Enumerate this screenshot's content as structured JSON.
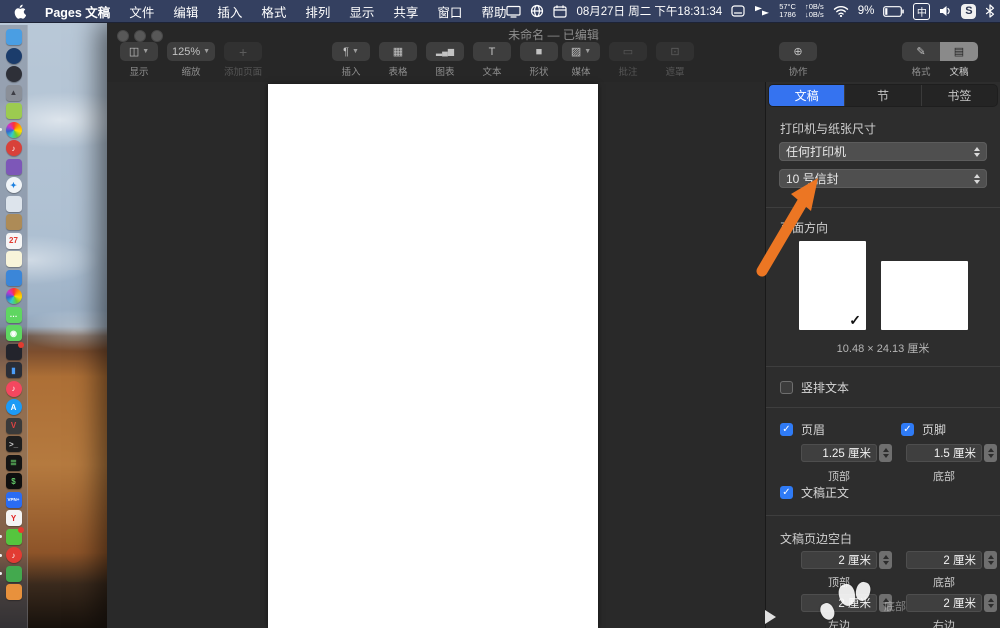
{
  "menubar": {
    "app_name": "Pages 文稿",
    "menus": [
      "文件",
      "编辑",
      "插入",
      "格式",
      "排列",
      "显示",
      "共享",
      "窗口",
      "帮助"
    ],
    "status": {
      "date_time": "08月27日 周二 下午18:31:34",
      "temp_top": "57°C",
      "temp_bottom": "1786",
      "net_up": "↑0B/s",
      "net_down": "↓0B/s",
      "battery_pct": "9%",
      "input_method": "中",
      "sogou": "S",
      "icons": [
        "display-icon",
        "globe-icon",
        "calendar-icon",
        "touchbar-icon",
        "flags-icon",
        "wifi-icon",
        "battery-icon",
        "input-method-badge",
        "speaker-icon",
        "sogou-badge",
        "bluetooth-icon"
      ]
    }
  },
  "window": {
    "title": "未命名 — 已编辑",
    "toolbar": {
      "groups": [
        [
          {
            "name": "view",
            "label": "显示",
            "glyph": "◫",
            "chevron": true
          },
          {
            "name": "zoom",
            "label": "缩放",
            "glyph": "125%",
            "chevron": true
          },
          {
            "name": "add-page",
            "label": "添加页面",
            "glyph": "+",
            "disabled": true
          }
        ],
        [
          {
            "name": "insert",
            "label": "插入",
            "glyph": "¶",
            "chevron": true
          },
          {
            "name": "table",
            "label": "表格",
            "glyph": "▦"
          },
          {
            "name": "chart",
            "label": "图表",
            "glyph": "▂▄▆"
          },
          {
            "name": "text",
            "label": "文本",
            "glyph": "T"
          },
          {
            "name": "shape",
            "label": "形状",
            "glyph": "■"
          }
        ],
        [
          {
            "name": "media",
            "label": "媒体",
            "glyph": "▨",
            "chevron": true
          },
          {
            "name": "comment",
            "label": "批注",
            "glyph": "▭",
            "disabled": true
          },
          {
            "name": "mask",
            "label": "遮罩",
            "glyph": "⊡",
            "disabled": true
          }
        ],
        [
          {
            "name": "collaborate",
            "label": "协作",
            "glyph": "⊕"
          }
        ],
        [
          {
            "name": "format",
            "label": "格式",
            "glyph": "✎"
          },
          {
            "name": "document",
            "label": "文稿",
            "glyph": "▤",
            "active": true
          }
        ]
      ]
    }
  },
  "sidebar": {
    "tabs": [
      {
        "label": "文稿",
        "active": true
      },
      {
        "label": "节",
        "active": false
      },
      {
        "label": "书签",
        "active": false
      }
    ],
    "printer": {
      "title": "打印机与纸张尺寸",
      "printer_value": "任何打印机",
      "paper_value": "10 号信封"
    },
    "orientation": {
      "title": "页面方向",
      "size_label": "10.48 × 24.13 厘米"
    },
    "vertical_text": {
      "label": "竖排文本",
      "checked": false
    },
    "header": {
      "label": "页眉",
      "checked": true,
      "value": "1.25 厘米",
      "pos": "顶部"
    },
    "footer": {
      "label": "页脚",
      "checked": true,
      "value": "1.5 厘米",
      "pos": "底部"
    },
    "body_label": "文稿正文",
    "margins": {
      "title": "文稿页边空白",
      "top": {
        "value": "2 厘米",
        "label": "顶部"
      },
      "bottom": {
        "value": "2 厘米",
        "label": "底部"
      },
      "left": {
        "value": "2 厘米",
        "label": "左边"
      },
      "right": {
        "value": "2 厘米",
        "label": "右边"
      },
      "ghost": "底部"
    }
  },
  "annotation": {
    "arrow_color": "#ec7623"
  },
  "colors": {
    "menubar_bg": "#344060",
    "toolbar_bg": "#272727",
    "sidebar_bg": "#2d2d2d",
    "accent_blue": "#3573f0",
    "checkbox_blue": "#2f7bf6"
  },
  "dock": {
    "items": [
      {
        "name": "finder",
        "color": "#4a9ee3"
      },
      {
        "name": "app-store-circle",
        "color": "#1b3c6b",
        "round": true
      },
      {
        "name": "maps-dark",
        "color": "#2e3038",
        "round": true
      },
      {
        "name": "launchpad",
        "color": "#8a8f98",
        "glyph": "▲",
        "glyphColor": "#3e3e46"
      },
      {
        "name": "android-emulator",
        "color": "#9ccb50"
      },
      {
        "name": "color-wheel",
        "conic": true,
        "round": true,
        "running": true
      },
      {
        "name": "netease-red",
        "color": "#d8413a",
        "round": true,
        "glyph": "♪",
        "glyphColor": "#ffffff"
      },
      {
        "name": "purple-app",
        "color": "#7d57b8"
      },
      {
        "name": "safari",
        "color": "#f0f4f8",
        "round": true,
        "glyph": "✦",
        "glyphColor": "#1b7fe0"
      },
      {
        "name": "preview",
        "color": "#dde4ec"
      },
      {
        "name": "books",
        "color": "#ad8b57"
      },
      {
        "name": "calendar",
        "color": "#f6f6f6",
        "glyph": "27",
        "glyphColor": "#e03a30"
      },
      {
        "name": "notes",
        "color": "#f8f4da"
      },
      {
        "name": "drawing-blue",
        "color": "#3b86d8"
      },
      {
        "name": "photos",
        "conic": true,
        "round": true
      },
      {
        "name": "messages",
        "color": "#5fd661",
        "glyph": "…",
        "glyphColor": "#ffffff"
      },
      {
        "name": "facetime",
        "color": "#5fd661",
        "glyph": "◉",
        "glyphColor": "#ffffff"
      },
      {
        "name": "qq-dark",
        "color": "#23242c",
        "badge": true
      },
      {
        "name": "keynote",
        "color": "#2a2e37",
        "glyph": "▮",
        "glyphColor": "#4b9df8"
      },
      {
        "name": "itunes",
        "color": "#f4475f",
        "round": true,
        "glyph": "♪",
        "glyphColor": "#ffffff"
      },
      {
        "name": "app-store",
        "color": "#1d9bf6",
        "round": true,
        "glyph": "A",
        "glyphColor": "#ffffff"
      },
      {
        "name": "v-app",
        "color": "#3a3a3a",
        "glyph": "V",
        "glyphColor": "#e04343"
      },
      {
        "name": "terminal-1",
        "color": "#1e1e1e",
        "glyph": "&gt;_",
        "glyphColor": "#cccccc"
      },
      {
        "name": "terminal-2",
        "color": "#141414",
        "glyph": "≣",
        "glyphColor": "#66d06a"
      },
      {
        "name": "terminal-3",
        "color": "#0f0f0f",
        "glyph": "$",
        "glyphColor": "#62c968"
      },
      {
        "name": "vpn",
        "color": "#2a6cf4",
        "glyph": "VPN+",
        "glyphColor": "#ffffff",
        "tiny": true
      },
      {
        "name": "yandex",
        "color": "#f4f4f4",
        "glyph": "Y",
        "glyphColor": "#e02020"
      },
      {
        "name": "wechat",
        "color": "#55c53e",
        "running": true,
        "badge": true
      },
      {
        "name": "music-red",
        "color": "#e23c33",
        "round": true,
        "glyph": "♪",
        "glyphColor": "#ffffff",
        "running": true
      },
      {
        "name": "camera-green",
        "color": "#43a94e",
        "running": true
      },
      {
        "name": "orange-app",
        "color": "#e8913c"
      }
    ]
  }
}
